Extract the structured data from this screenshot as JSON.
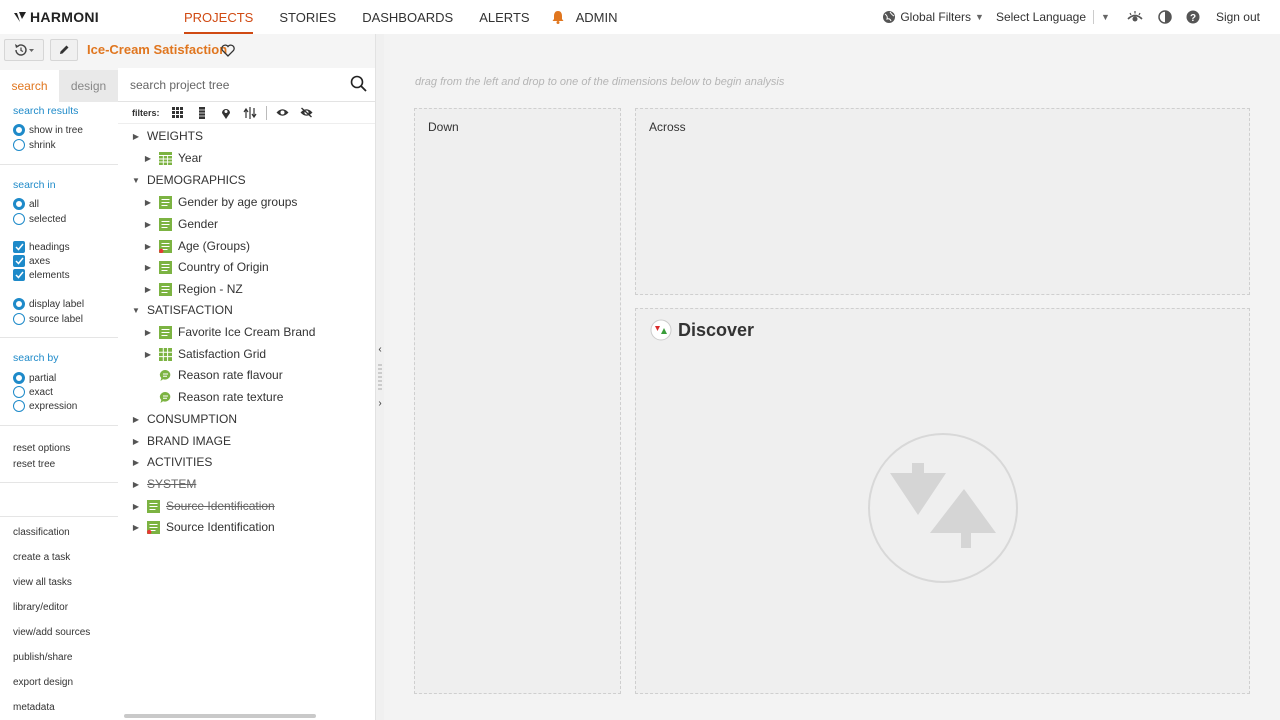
{
  "app": {
    "logo_text": "HARMONI"
  },
  "nav": {
    "items": [
      {
        "label": "PROJECTS",
        "active": true
      },
      {
        "label": "STORIES",
        "active": false
      },
      {
        "label": "DASHBOARDS",
        "active": false
      },
      {
        "label": "ALERTS",
        "active": false
      },
      {
        "label": "ADMIN",
        "active": false
      }
    ],
    "global_filters": "Global Filters",
    "select_language": "Select Language",
    "sign_out": "Sign out"
  },
  "project": {
    "title": "Ice-Cream Satisfaction"
  },
  "tabs": {
    "search": "search",
    "design": "design"
  },
  "search_options": {
    "results_title": "search results",
    "show_in_tree": "show in tree",
    "shrink": "shrink",
    "search_in_title": "search in",
    "all": "all",
    "selected": "selected",
    "headings": "headings",
    "axes": "axes",
    "elements": "elements",
    "display_label": "display label",
    "source_label": "source label",
    "search_by_title": "search by",
    "partial": "partial",
    "exact": "exact",
    "expression": "expression",
    "reset_options": "reset options",
    "reset_tree": "reset tree"
  },
  "bottom_links": [
    "classification",
    "create a task",
    "view all tasks",
    "library/editor",
    "view/add sources",
    "publish/share",
    "export design",
    "metadata"
  ],
  "search": {
    "placeholder": "search project tree"
  },
  "filters_label": "filters:",
  "tree": [
    {
      "label": "WEIGHTS",
      "level": 0,
      "type": "heading",
      "expanded": false
    },
    {
      "label": "Year",
      "level": 1,
      "type": "table-icon",
      "expanded": false
    },
    {
      "label": "DEMOGRAPHICS",
      "level": 0,
      "type": "heading",
      "expanded": true
    },
    {
      "label": "Gender by age groups",
      "level": 1,
      "type": "list-icon",
      "expanded": false
    },
    {
      "label": "Gender",
      "level": 1,
      "type": "list-icon",
      "expanded": false
    },
    {
      "label": "Age (Groups)",
      "level": 1,
      "type": "list-red-icon",
      "expanded": false
    },
    {
      "label": "Country of Origin",
      "level": 1,
      "type": "list-icon",
      "expanded": false
    },
    {
      "label": "Region - NZ",
      "level": 1,
      "type": "list-icon",
      "expanded": false
    },
    {
      "label": "SATISFACTION",
      "level": 0,
      "type": "heading",
      "expanded": true
    },
    {
      "label": "Favorite Ice Cream Brand",
      "level": 1,
      "type": "list-icon",
      "expanded": false
    },
    {
      "label": "Satisfaction Grid",
      "level": 1,
      "type": "grid-icon",
      "expanded": false
    },
    {
      "label": "Reason rate flavour",
      "level": 1,
      "type": "comment-icon",
      "expanded": null
    },
    {
      "label": "Reason rate texture",
      "level": 1,
      "type": "comment-icon",
      "expanded": null
    },
    {
      "label": "CONSUMPTION",
      "level": 0,
      "type": "heading",
      "expanded": false
    },
    {
      "label": "BRAND IMAGE",
      "level": 0,
      "type": "heading",
      "expanded": false
    },
    {
      "label": "ACTIVITIES",
      "level": 0,
      "type": "heading",
      "expanded": false
    },
    {
      "label": "SYSTEM",
      "level": 0,
      "type": "heading-strike",
      "expanded": false
    },
    {
      "label": "Source Identification",
      "level": 0,
      "type": "list-strike-icon",
      "expanded": false
    },
    {
      "label": "Source Identification",
      "level": 0,
      "type": "list-red-icon",
      "expanded": false
    }
  ],
  "main": {
    "hint": "drag from the left and drop to one of the dimensions below to begin analysis",
    "down": "Down",
    "across": "Across",
    "discover": "Discover"
  },
  "colors": {
    "accent": "#e0761f",
    "link": "#1e8ac9",
    "green": "#7cb342"
  }
}
